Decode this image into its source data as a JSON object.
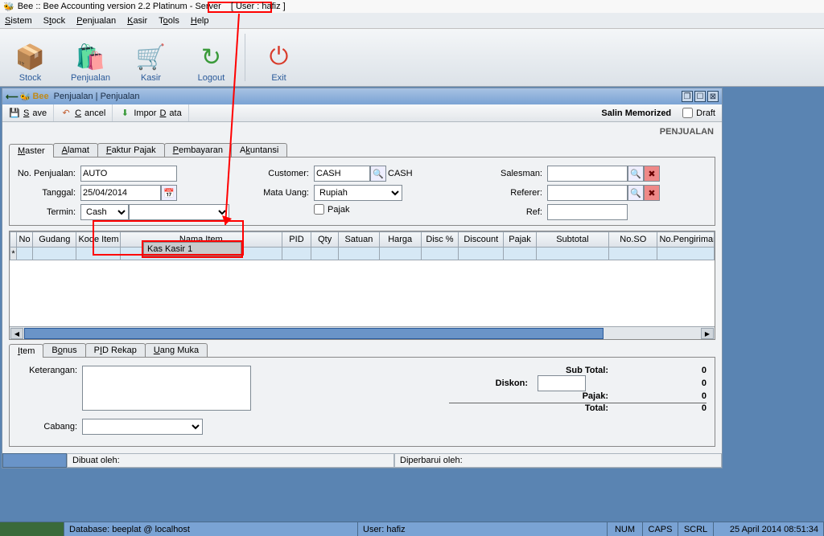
{
  "title": {
    "app": "Bee :: Bee Accounting version 2.2 Platinum - Server",
    "user": "[ User : hafiz ]"
  },
  "menu": [
    "Sistem",
    "Stock",
    "Penjualan",
    "Kasir",
    "Tools",
    "Help"
  ],
  "toolbar": [
    {
      "id": "stock",
      "label": "Stock",
      "color": "#d9a23a"
    },
    {
      "id": "penjualan",
      "label": "Penjualan",
      "color": "#2a5a9a"
    },
    {
      "id": "kasir",
      "label": "Kasir",
      "color": "#d9a23a"
    },
    {
      "id": "logout",
      "label": "Logout",
      "color": "#3a9a3a"
    },
    {
      "id": "exit",
      "label": "Exit",
      "color": "#d83a2a"
    }
  ],
  "window": {
    "brand": "Bee",
    "title": "Penjualan | Penjualan",
    "buttons": {
      "save": "Save",
      "cancel": "Cancel",
      "impor": "Impor Data",
      "salin": "Salin Memorized",
      "draft": "Draft"
    },
    "pagelabel": "PENJUALAN"
  },
  "tabs_master": [
    "Master",
    "Alamat",
    "Faktur Pajak",
    "Pembayaran",
    "Akuntansi"
  ],
  "fields": {
    "no_penjualan": {
      "label": "No. Penjualan:",
      "value": "AUTO"
    },
    "tanggal": {
      "label": "Tanggal:",
      "value": "25/04/2014"
    },
    "termin": {
      "label": "Termin:",
      "value": "Cash",
      "dropdown_value": "",
      "dropdown_option": "Kas Kasir 1"
    },
    "customer": {
      "label": "Customer:",
      "value": "CASH",
      "display": "CASH"
    },
    "mata_uang": {
      "label": "Mata Uang:",
      "value": "Rupiah"
    },
    "pajak": {
      "label": "Pajak"
    },
    "salesman": {
      "label": "Salesman:"
    },
    "referer": {
      "label": "Referer:"
    },
    "ref": {
      "label": "Ref:"
    }
  },
  "grid_cols": [
    "No",
    "Gudang",
    "Kode Item",
    "Nama Item",
    "PID",
    "Qty",
    "Satuan",
    "Harga",
    "Disc %",
    "Discount",
    "Pajak",
    "Subtotal",
    "No.SO",
    "No.Pengiriman"
  ],
  "tabs_bottom": [
    "Item",
    "Bonus",
    "PID Rekap",
    "Uang Muka"
  ],
  "bottom": {
    "keterangan": "Keterangan:",
    "cabang": "Cabang:"
  },
  "totals": {
    "sub_total": {
      "label": "Sub Total:",
      "value": "0"
    },
    "diskon": {
      "label": "Diskon:",
      "value": "0",
      "input": ""
    },
    "pajak": {
      "label": "Pajak:",
      "value": "0"
    },
    "total": {
      "label": "Total:",
      "value": "0"
    }
  },
  "audit": {
    "dibuat": "Dibuat oleh:",
    "diperbarui": "Diperbarui oleh:"
  },
  "status": {
    "db": "Database: beeplat @ localhost",
    "user": "User: hafiz",
    "num": "NUM",
    "caps": "CAPS",
    "scrl": "SCRL",
    "datetime": "25 April 2014  08:51:34"
  }
}
